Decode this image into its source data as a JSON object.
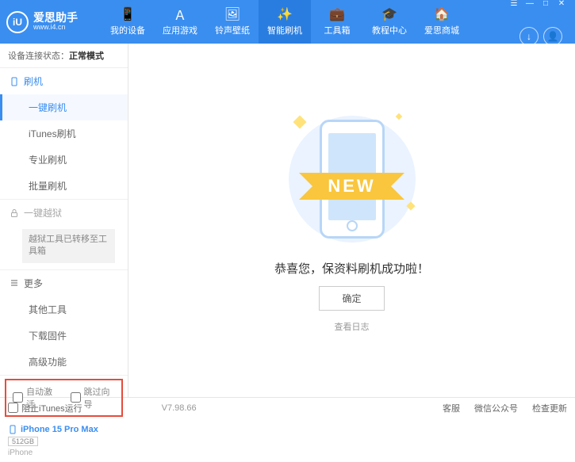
{
  "header": {
    "logo_text": "爱思助手",
    "logo_url": "www.i4.cn",
    "logo_mark": "iU",
    "nav": [
      {
        "label": "我的设备",
        "icon": "📱"
      },
      {
        "label": "应用游戏",
        "icon": "Ａ"
      },
      {
        "label": "铃声壁纸",
        "icon": "🖼"
      },
      {
        "label": "智能刷机",
        "icon": "✨"
      },
      {
        "label": "工具箱",
        "icon": "💼"
      },
      {
        "label": "教程中心",
        "icon": "🎓"
      },
      {
        "label": "爱思商城",
        "icon": "🏠"
      }
    ]
  },
  "sidebar": {
    "status_label": "设备连接状态：",
    "status_value": "正常模式",
    "section_flash": "刷机",
    "items_flash": [
      "一键刷机",
      "iTunes刷机",
      "专业刷机",
      "批量刷机"
    ],
    "section_jailbreak": "一键越狱",
    "jailbreak_note": "越狱工具已转移至工具箱",
    "section_more": "更多",
    "items_more": [
      "其他工具",
      "下载固件",
      "高级功能"
    ],
    "checkbox_auto": "自动激活",
    "checkbox_skip": "跳过向导",
    "device_model": "iPhone 15 Pro Max",
    "device_storage": "512GB",
    "device_type": "iPhone"
  },
  "main": {
    "ribbon": "NEW",
    "success_text": "恭喜您，保资料刷机成功啦！",
    "confirm_btn": "确定",
    "view_log": "查看日志"
  },
  "footer": {
    "block_itunes": "阻止iTunes运行",
    "version": "V7.98.66",
    "links": [
      "客服",
      "微信公众号",
      "检查更新"
    ]
  }
}
